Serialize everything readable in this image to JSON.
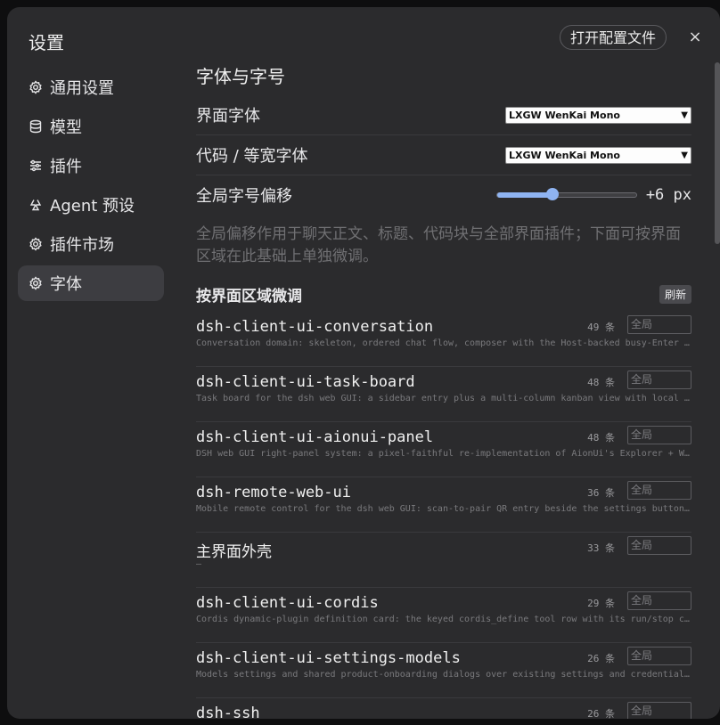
{
  "dialog": {
    "title": "设置",
    "open_config_label": "打开配置文件",
    "close_label": "×"
  },
  "sidebar": {
    "items": [
      {
        "label": "通用设置",
        "icon": "gear-icon"
      },
      {
        "label": "模型",
        "icon": "database-icon"
      },
      {
        "label": "插件",
        "icon": "sliders-icon"
      },
      {
        "label": "Agent 预设",
        "icon": "recycle-icon"
      },
      {
        "label": "插件市场",
        "icon": "gear-icon"
      },
      {
        "label": "字体",
        "icon": "gear-icon",
        "active": true
      }
    ]
  },
  "fonts": {
    "section_title": "字体与字号",
    "ui_font_label": "界面字体",
    "ui_font_value": "LXGW WenKai Mono",
    "code_font_label": "代码 / 等宽字体",
    "code_font_value": "LXGW WenKai Mono",
    "offset_label": "全局字号偏移",
    "offset_value": "+6 px",
    "offset_fraction": 0.4,
    "description": "全局偏移作用于聊天正文、标题、代码块与全部界面插件；下面可按界面区域在此基础上单独微调。",
    "area_title": "按界面区域微调",
    "refresh_label": "刷新"
  },
  "plugins": [
    {
      "name": "dsh-client-ui-conversation",
      "desc": "Conversation domain: skeleton, ordered chat flow, composer with the Host-backed busy-Enter queue, and the Agent live-preview surfaces.",
      "count": "49 条",
      "placeholder": "全局"
    },
    {
      "name": "dsh-client-ui-task-board",
      "desc": "Task board for the dsh web GUI: a sidebar entry plus a multi-column kanban view with local persistence.",
      "count": "48 条",
      "placeholder": "全局"
    },
    {
      "name": "dsh-client-ui-aionui-panel",
      "desc": "DSH web GUI right-panel system: a pixel-faithful re-implementation of AionUi's Explorer + Workspace.",
      "count": "48 条",
      "placeholder": "全局"
    },
    {
      "name": "dsh-remote-web-ui",
      "desc": "Mobile remote control for the dsh web GUI: scan-to-pair QR entry beside the settings button and more.",
      "count": "36 条",
      "placeholder": "全局"
    },
    {
      "name": "主界面外壳",
      "desc": "—",
      "count": "33 条",
      "placeholder": "全局"
    },
    {
      "name": "dsh-client-ui-cordis",
      "desc": "Cordis dynamic-plugin definition card: the keyed cordis_define tool row with its run/stop controls and logs.",
      "count": "29 条",
      "placeholder": "全局"
    },
    {
      "name": "dsh-client-ui-settings-models",
      "desc": "Models settings and shared product-onboarding dialogs over existing settings and credentials.",
      "count": "26 条",
      "placeholder": "全局"
    },
    {
      "name": "dsh-ssh",
      "desc": "",
      "count": "26 条",
      "placeholder": "全局"
    }
  ]
}
